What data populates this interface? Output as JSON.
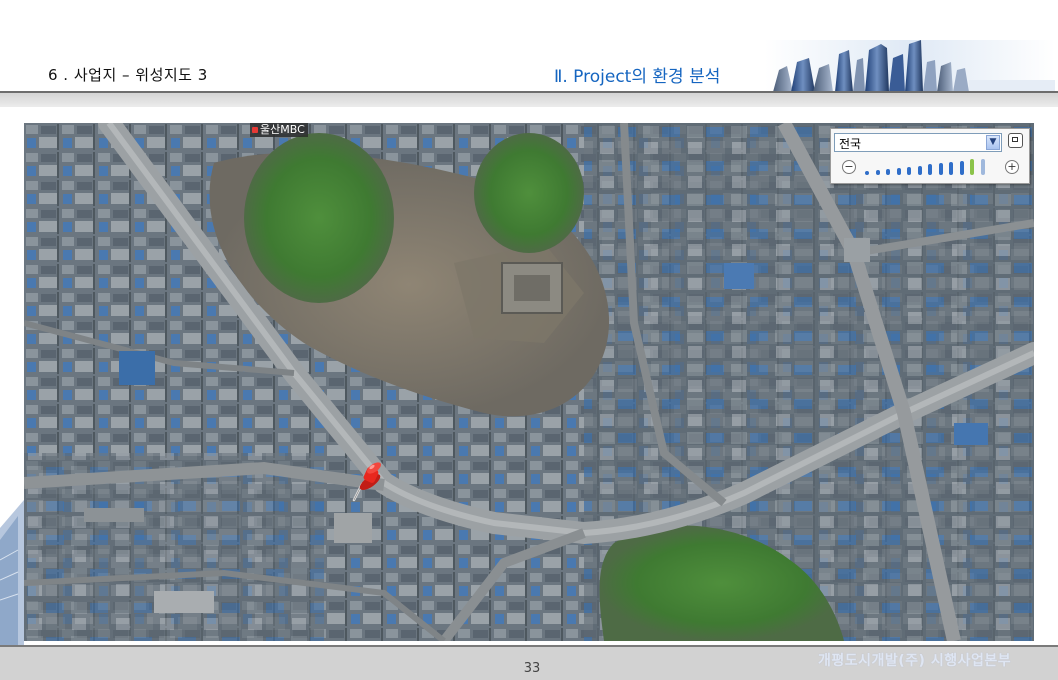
{
  "header": {
    "section_title": "6 . 사업지 – 위성지도 3",
    "chapter_title": "Ⅱ.  Project의 환경 분석"
  },
  "map": {
    "landmark_label": "울산MBC",
    "pin_icon": "push-pin-icon",
    "zoom_control": {
      "region_select": {
        "value": "전국"
      },
      "minimize_icon": "minimize-icon",
      "zoom_out_label": "−",
      "zoom_in_label": "+",
      "zoom_level": 10,
      "zoom_levels": 12
    }
  },
  "footer": {
    "page_number": "33",
    "company": "개평도시개발(주) 시행사업본부"
  },
  "colors": {
    "chapter_title": "#1565c0",
    "pin": "#e8281e",
    "zoom_active": "#8bc34a",
    "zoom_step": "#2f6ec9"
  }
}
